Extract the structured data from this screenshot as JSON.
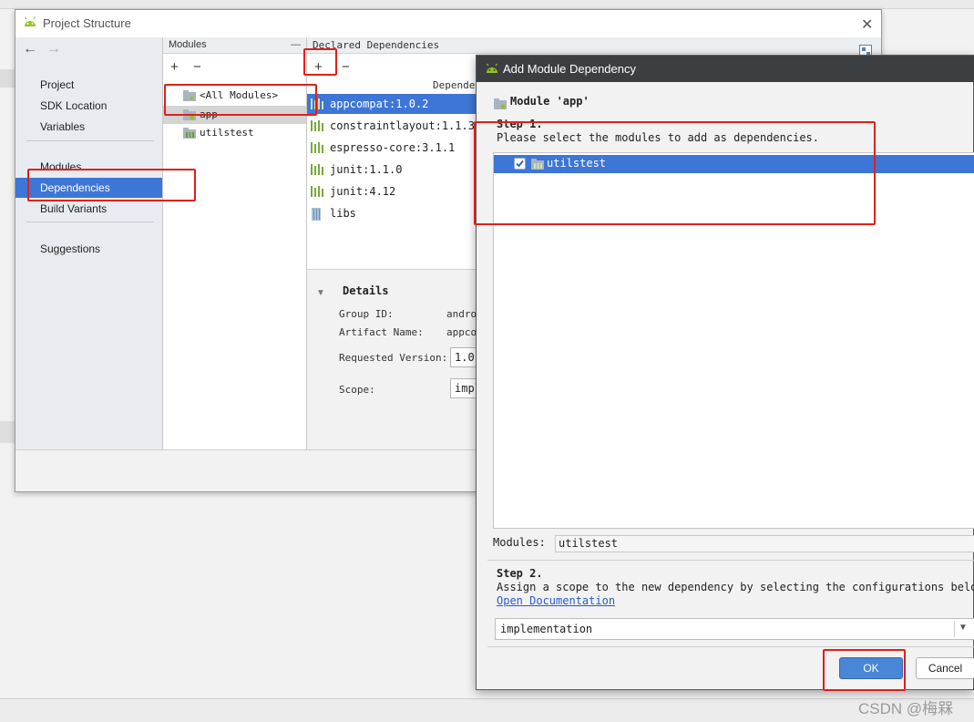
{
  "project_structure": {
    "title": "Project Structure",
    "close_glyph": "✕",
    "nav": {
      "back_glyph": "←",
      "forward_glyph": "→"
    },
    "sidebar": {
      "groups": [
        [
          "Project",
          "SDK Location",
          "Variables"
        ],
        [
          "Modules",
          "Dependencies",
          "Build Variants"
        ],
        [
          "Suggestions"
        ]
      ],
      "selected": "Dependencies"
    },
    "modules_panel": {
      "header": "Modules",
      "header_dash": "—",
      "add_glyph": "+",
      "remove_glyph": "−",
      "items": [
        "<All Modules>",
        "app",
        "utilstest"
      ],
      "selected": "app"
    },
    "dependencies_panel": {
      "header": "Declared Dependencies",
      "add_glyph": "+",
      "remove_glyph": "−",
      "column_header": "Depende",
      "items": [
        "appcompat:1.0.2",
        "constraintlayout:1.1.3",
        "espresso-core:3.1.1",
        "junit:1.1.0",
        "junit:4.12",
        "libs"
      ],
      "selected": "appcompat:1.0.2",
      "details": {
        "toggle_glyph": "▼",
        "title": "Details",
        "group_id_label": "Group ID:",
        "group_id_value": "andro",
        "artifact_name_label": "Artifact Name:",
        "artifact_name_value": "appco",
        "requested_version_label": "Requested Version:",
        "requested_version_value": "1.0",
        "scope_label": "Scope:",
        "scope_value": "impl"
      }
    }
  },
  "add_module_dependency": {
    "title": "Add Module Dependency",
    "module_heading": "Module 'app'",
    "step1_title": "Step 1.",
    "step1_desc": "Please select the modules to add as dependencies.",
    "list_items": [
      {
        "label": "utilstest",
        "checked": true
      }
    ],
    "check_glyph": "✓",
    "modules_field_label": "Modules:",
    "modules_field_value": "utilstest",
    "step2_title": "Step 2.",
    "step2_desc": "Assign a scope to the new dependency by selecting the configurations below.",
    "doc_link": "Open Documentation",
    "scope": {
      "value": "implementation",
      "arrow_glyph": "▼"
    },
    "ok_label": "OK",
    "cancel_label": "Cancel"
  },
  "watermark": "CSDN @梅槑",
  "colors": {
    "selection": "#3d76d6",
    "annotation_red": "#e0201a",
    "dialog_titlebar": "#3c3f41",
    "android_green": "#97c024"
  }
}
